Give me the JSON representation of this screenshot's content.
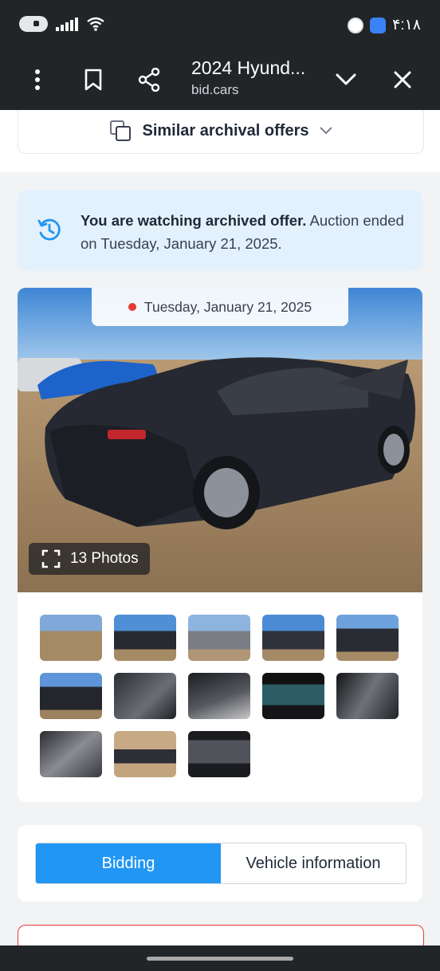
{
  "status_bar": {
    "time": "۴:۱۸"
  },
  "browser": {
    "page_title": "2024 Hyund...",
    "domain": "bid.cars"
  },
  "similar": {
    "label": "Similar archival offers"
  },
  "notice": {
    "bold": "You are watching archived offer.",
    "rest": " Auction ended on Tuesday, January 21, 2025."
  },
  "gallery": {
    "date": "Tuesday, January 21, 2025",
    "photos_label": "13 Photos"
  },
  "tabs": {
    "bidding": "Bidding",
    "vehicle_info": "Vehicle information",
    "active": "bidding"
  },
  "colors": {
    "accent": "#2196f3",
    "notice_bg": "#e3f1fd",
    "alert": "#e53935",
    "chrome": "#222528"
  }
}
